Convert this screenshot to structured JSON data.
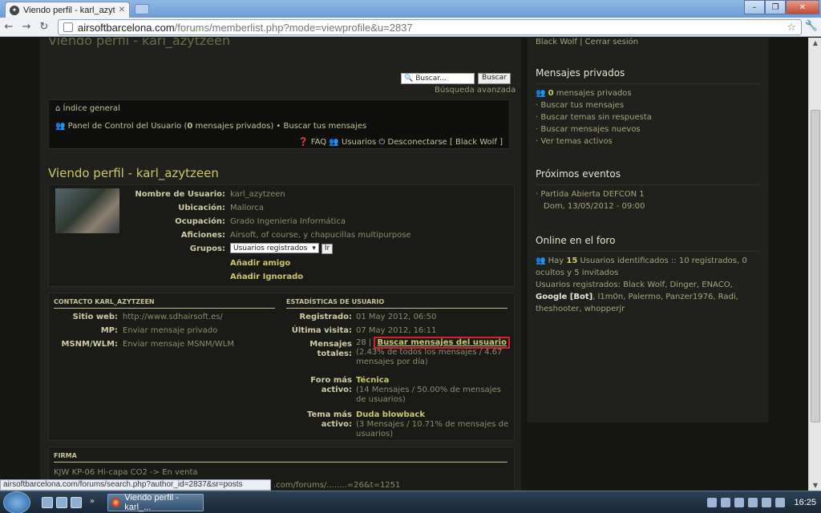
{
  "browser": {
    "tab_title": "Viendo perfil - karl_azytzeen",
    "url_host": "airsoftbarcelona.com",
    "url_path": "/forums/memberlist.php?mode=viewprofile&u=2837",
    "status_url": "airsoftbarcelona.com/forums/search.php?author_id=2837&sr=posts"
  },
  "page": {
    "faded_title": "Viendo perfil - karl_azytzeen",
    "search_placeholder": "Buscar...",
    "search_button": "Buscar",
    "advanced_search": "Búsqueda avanzada",
    "nav_index": "Índice general",
    "nav_ucp_prefix": "Panel de Control del Usuario (",
    "nav_ucp_count": "0",
    "nav_ucp_suffix": " mensajes privados)",
    "nav_sep": " • ",
    "nav_search_mine": "Buscar tus mensajes",
    "nav_faq": "FAQ",
    "nav_users": "Usuarios",
    "nav_logout": "Desconectarse [ Black Wolf ]",
    "title": "Viendo perfil - karl_azytzeen"
  },
  "profile": {
    "username_label": "Nombre de Usuario:",
    "username": "karl_azytzeen",
    "location_label": "Ubicación:",
    "location": "Mallorca",
    "occupation_label": "Ocupación:",
    "occupation": "Grado Ingenieria Informática",
    "interests_label": "Aficiones:",
    "interests": "Airsoft, of course, y chapucillas multipurpose",
    "groups_label": "Grupos:",
    "group_selected": "Usuarios registrados",
    "go_button": "Ir",
    "add_friend": "Añadir amigo",
    "add_ignored": "Añadir Ignorado"
  },
  "contact": {
    "heading": "CONTACTO KARL_AZYTZEEN",
    "website_label": "Sitio web:",
    "website": "http://www.sdhairsoft.es/",
    "pm_label": "MP:",
    "pm": "Enviar mensaje privado",
    "msnm_label": "MSNM/WLM:",
    "msnm": "Enviar mensaje MSNM/WLM"
  },
  "stats": {
    "heading": "ESTADÍSTICAS DE USUARIO",
    "registered_label": "Registrado:",
    "registered": "01 May 2012, 06:50",
    "lastvisit_label": "Última visita:",
    "lastvisit": "07 May 2012, 16:11",
    "posts_label_1": "Mensajes",
    "posts_label_2": "totales:",
    "posts_count": "28",
    "posts_search": "Buscar mensajes del usuario",
    "posts_pct_1": "(2.43% de todos los mensajes / 4.67",
    "posts_pct_2": "mensajes por día)",
    "forum_label_1": "Foro más",
    "forum_label_2": "activo:",
    "forum_name": "Técnica",
    "forum_detail_1": "(14 Mensajes / 50.00% de mensajes",
    "forum_detail_2": "de usuarios)",
    "topic_label_1": "Tema más",
    "topic_label_2": "activo:",
    "topic_name": "Duda blowback",
    "topic_detail_1": "(3 Mensajes / 10.71% de mensajes de",
    "topic_detail_2": "usuarios)"
  },
  "signature": {
    "heading": "FIRMA",
    "line1": "KJW KP-06 Hi-capa CO2 -> En venta",
    "line2_fragment": ".com/forums/........=26&t=1251"
  },
  "sidebar": {
    "user_links": "Black Wolf | Cerrar sesión",
    "pm_title": "Mensajes privados",
    "pm_count": "0",
    "pm_text": " mensajes privados",
    "pm_links": [
      "Buscar tus mensajes",
      "Buscar temas sin respuesta",
      "Buscar mensajes nuevos",
      "Ver temas activos"
    ],
    "events_title": "Próximos eventos",
    "event_name": "Partida Abierta DEFCON 1",
    "event_date": "Dom, 13/05/2012 - 09:00",
    "online_title": "Online en el foro",
    "online_prefix": "Hay ",
    "online_count": "15",
    "online_text": " Usuarios identificados :: 10 registrados, 0 ocultos y 5 invitados",
    "registered_users_label": "Usuarios registrados: ",
    "registered_users_a": "Black Wolf, Dinger, ENACO, ",
    "registered_users_google": "Google [Bot]",
    "registered_users_b": ", l1m0n, Palermo, Panzer1976, Radi, theshooter, whopperjr"
  },
  "taskbar": {
    "task_title": "Viendo perfil - karl_...",
    "clock": "16:25"
  },
  "colors": {
    "accent_link": "#cbc86a",
    "highlight_box": "#d8202a",
    "bg": "#20201c"
  }
}
